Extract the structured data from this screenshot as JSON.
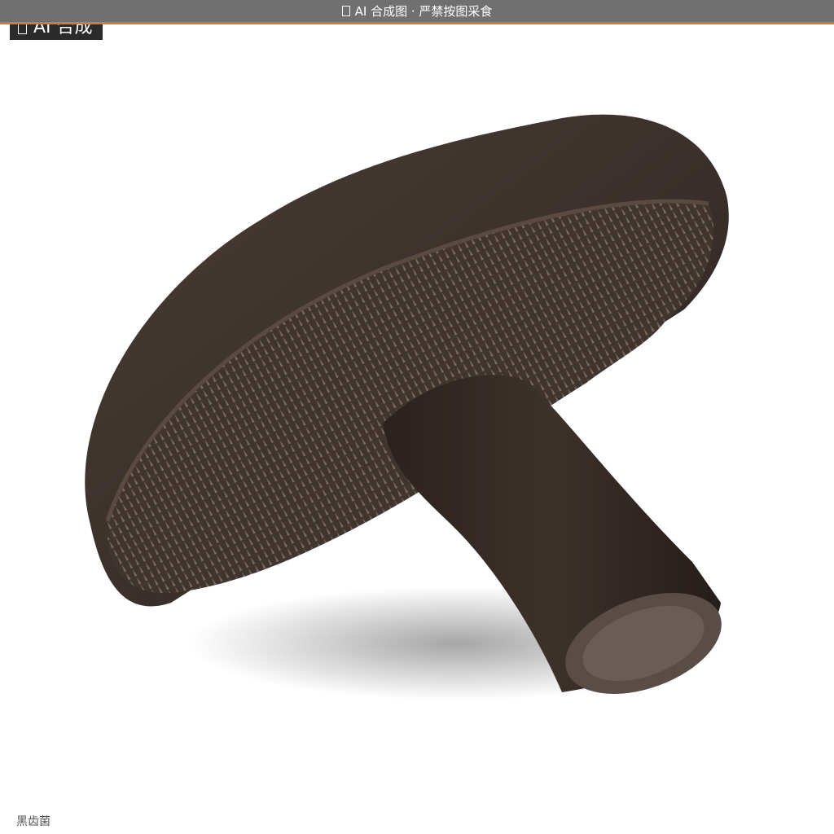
{
  "banner": {
    "icon": "warning-icon",
    "text": "AI 合成图 · 严禁按图采食"
  },
  "badge": {
    "icon": "ai-icon",
    "text": "AI 合成"
  },
  "caption": {
    "text": "黑齿菌"
  },
  "colors": {
    "banner_bg": "#707070",
    "banner_accent": "#d9782a",
    "badge_bg": "#2b2b2b",
    "mushroom_cap": "#3a2f2a",
    "spines": "#5e5048"
  },
  "photo": {
    "subject": "mushroom-photo"
  }
}
